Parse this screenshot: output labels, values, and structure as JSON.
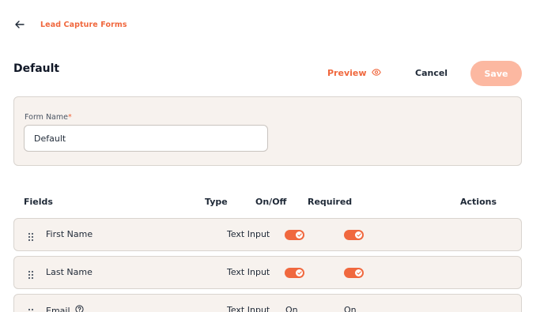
{
  "header": {
    "breadcrumb": "Lead Capture Forms",
    "page_title": "Default"
  },
  "actions": {
    "preview_label": "Preview",
    "cancel_label": "Cancel",
    "save_label": "Save"
  },
  "form": {
    "name_label": "Form Name",
    "required_mark": "*",
    "name_value": "Default"
  },
  "table": {
    "columns": [
      "Fields",
      "Type",
      "On/Off",
      "Required",
      "Actions"
    ],
    "rows": [
      {
        "field": "First Name",
        "type": "Text Input",
        "on_off": true,
        "required": true
      },
      {
        "field": "Last Name",
        "type": "Text Input",
        "on_off": true,
        "required": true
      },
      {
        "field": "Email",
        "type": "Text Input",
        "on_off_text": "On",
        "required_text": "On",
        "has_help_icon": true
      }
    ]
  },
  "icons": [
    "back-arrow-icon",
    "eye-icon",
    "drag-handle-icon",
    "check-icon",
    "help-circle-icon"
  ],
  "colors": {
    "accent": "#f0683e",
    "save_disabled": "#fcb8a1",
    "card_bg": "#f7f2ee",
    "card_border": "#d9d4cf"
  }
}
